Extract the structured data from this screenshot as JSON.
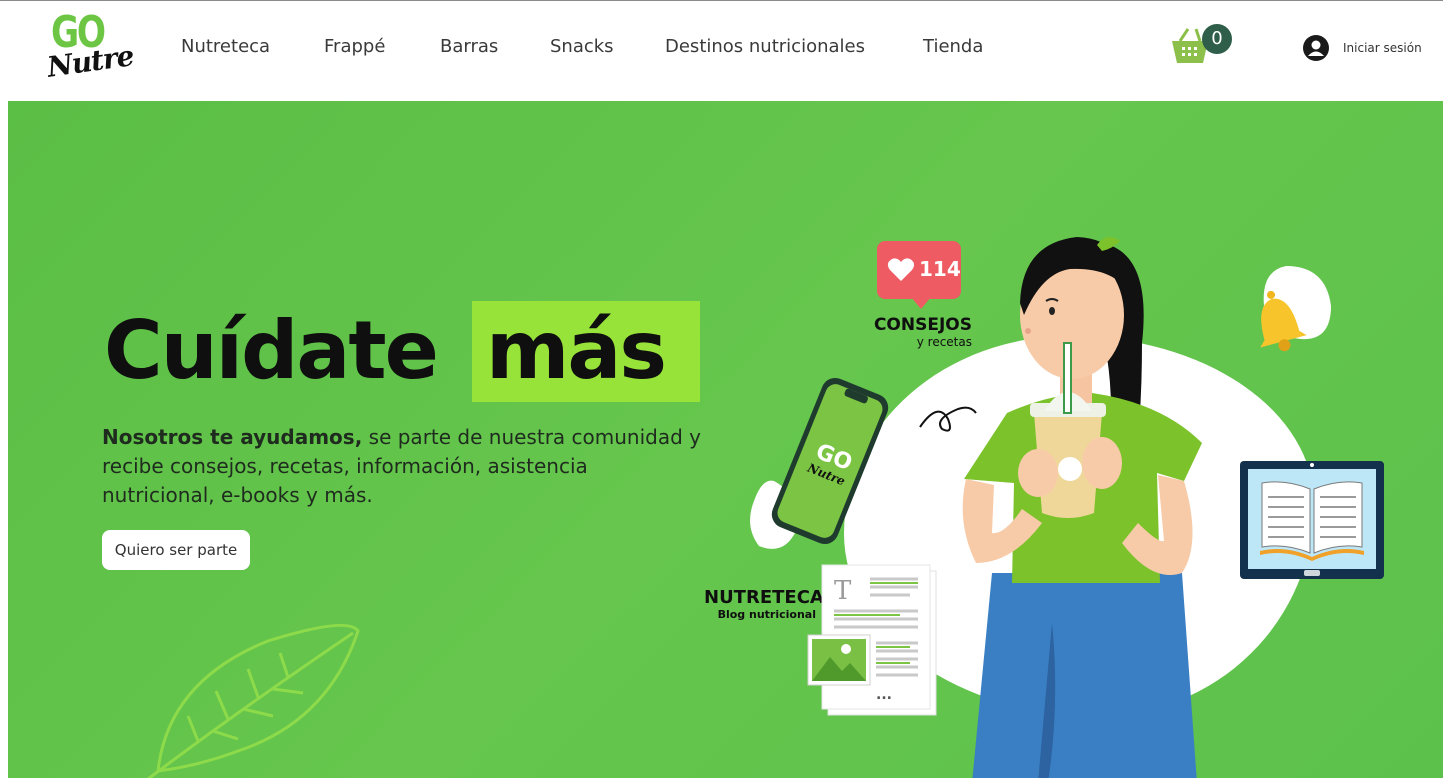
{
  "brand": {
    "logo_top": "GO",
    "logo_bottom": "Nutre",
    "accent": "#6cc644",
    "hero_bg": "#62c54b",
    "highlight": "#98e33a"
  },
  "nav": {
    "items": [
      "Nutreteca",
      "Frappé",
      "Barras",
      "Snacks",
      "Destinos nutricionales",
      "Tienda"
    ]
  },
  "cart": {
    "count": "0",
    "icon": "basket-icon"
  },
  "login": {
    "label": "Iniciar sesión",
    "icon": "user-avatar-icon"
  },
  "hero": {
    "title_part1": "Cuídate",
    "title_part2": "más",
    "lead_bold": "Nosotros te ayudamos,",
    "lead_rest": " se parte de nuestra comunidad y recibe consejos, recetas, información, asistencia nutricional, e-books y más.",
    "cta_label": "Quiero ser parte"
  },
  "illustration": {
    "likes": "114",
    "consejos_title": "CONSEJOS",
    "consejos_sub": "y recetas",
    "nutreteca_title": "NUTRETECA",
    "nutreteca_sub": "Blog nutricional",
    "phone_logo_top": "GO",
    "phone_logo_bottom": "Nutre",
    "doc_letter": "T",
    "doc_ellipsis": "..."
  }
}
